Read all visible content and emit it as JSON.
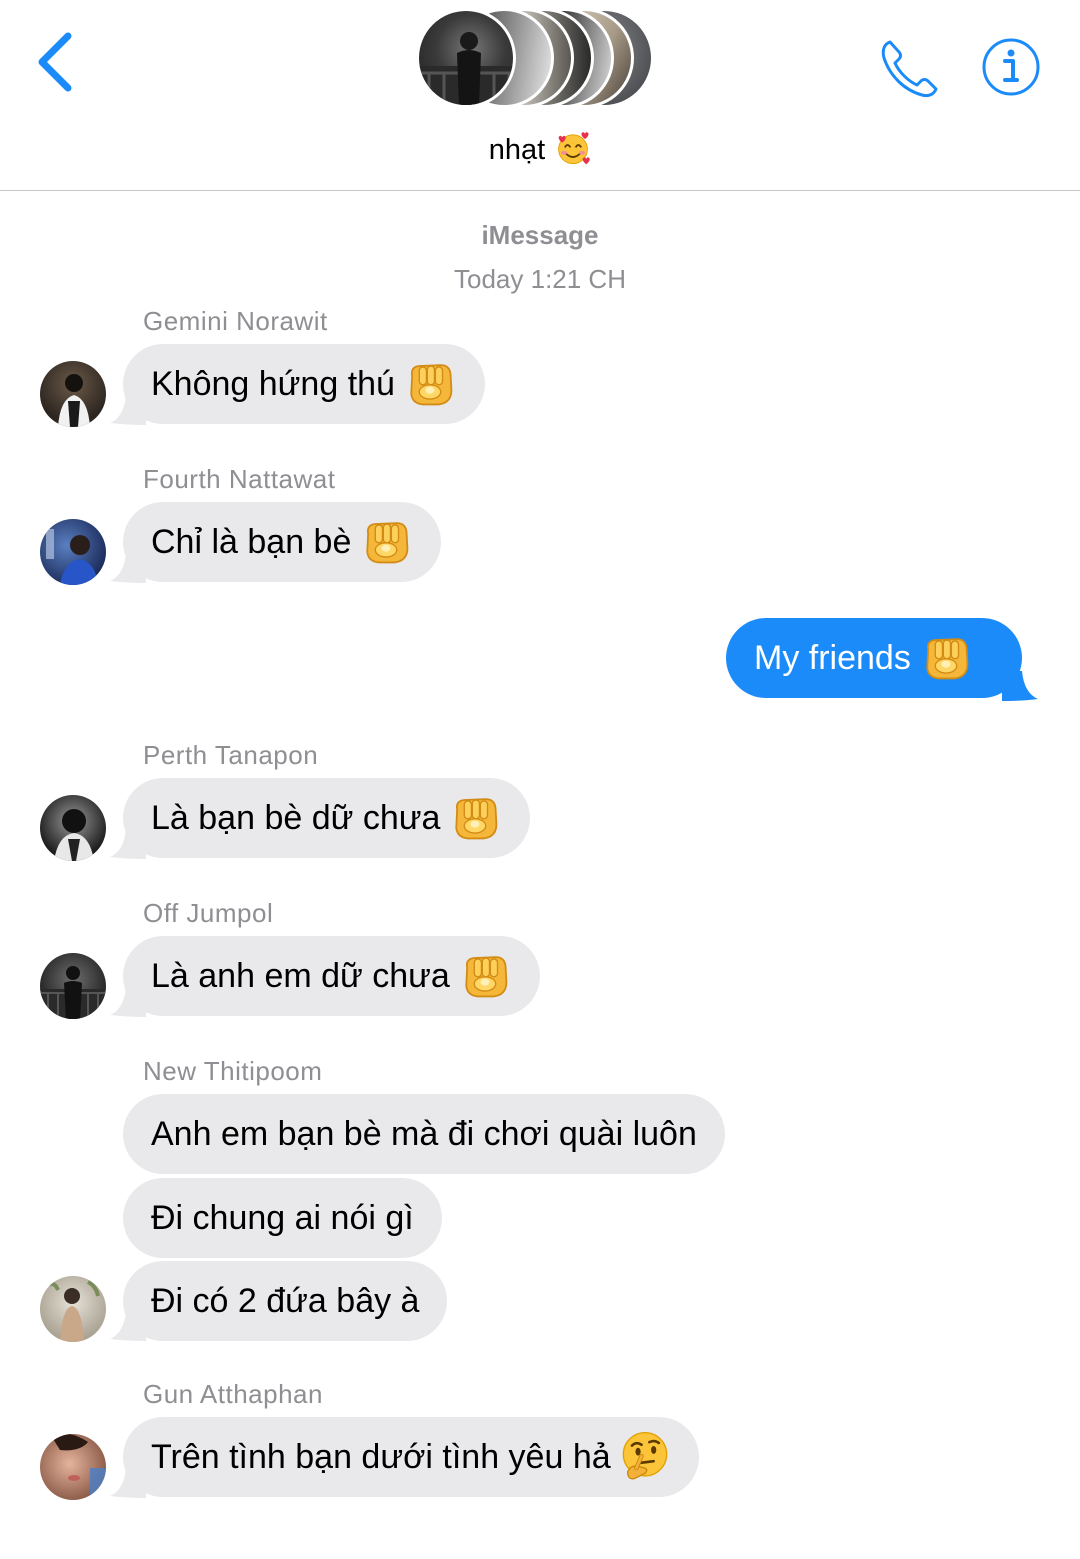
{
  "header": {
    "group_name": "nhạt",
    "group_emoji": "smiling-face-with-hearts",
    "accent_color": "#1c8bfa"
  },
  "meta": {
    "service": "iMessage",
    "timestamp": "Today 1:21 CH"
  },
  "messages": [
    {
      "sender": "Gemini Norawit",
      "text": "Không hứng thú",
      "emoji": "backhand-index-pointing-at-viewer"
    },
    {
      "sender": "Fourth Nattawat",
      "text": "Chỉ là bạn bè",
      "emoji": "backhand-index-pointing-at-viewer"
    },
    {
      "sender": "",
      "text": "My friends",
      "emoji": "backhand-index-pointing-at-viewer",
      "outgoing": true
    },
    {
      "sender": "Perth Tanapon",
      "text": "Là bạn bè dữ chưa",
      "emoji": "backhand-index-pointing-at-viewer"
    },
    {
      "sender": "Off Jumpol",
      "text": "Là anh em dữ chưa",
      "emoji": "backhand-index-pointing-at-viewer"
    },
    {
      "sender": "New Thitipoom",
      "text": "Anh em bạn bè mà đi chơi quài luôn"
    },
    {
      "sender": "",
      "text": "Đi chung ai nói gì"
    },
    {
      "sender": "",
      "text": "Đi có 2 đứa bây à"
    },
    {
      "sender": "Gun Atthaphan",
      "text": "Trên tình bạn dưới tình yêu hả",
      "emoji": "thinking-face"
    }
  ],
  "colors": {
    "incoming_bubble": "#e9e9eb",
    "outgoing_bubble": "#1c8bfa",
    "secondary_text": "#8e8e93"
  }
}
